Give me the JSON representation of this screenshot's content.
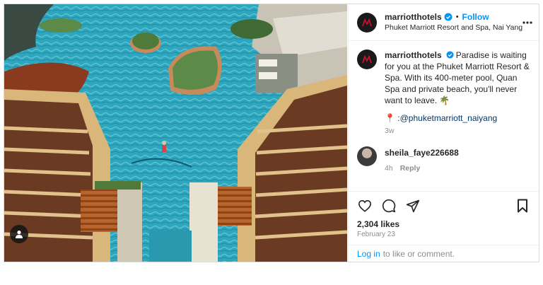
{
  "post": {
    "username": "marriotthotels",
    "follow_label": "Follow",
    "separator": "•",
    "location": "Phuket Marriott Resort and Spa, Nai Yang",
    "caption": "Paradise is waiting for you at the Phuket Marriott Resort & Spa. With its 400-meter pool, Quan Spa and private beach, you'll never want to leave. 🌴",
    "mention_prefix": "📍 : ",
    "mention": "@phuketmarriott_naiyang",
    "caption_age": "3w",
    "likes": "2,304 likes",
    "date": "February 23"
  },
  "reply": {
    "username": "sheila_faye226688",
    "age": "4h",
    "reply_label": "Reply"
  },
  "footer": {
    "login_link": "Log in",
    "login_text": "to like or comment."
  },
  "colors": {
    "accent": "#0095f6",
    "mention": "#00376b",
    "muted": "#8e8e8e"
  },
  "icons": [
    "verified-badge-icon",
    "more-options-icon",
    "heart-icon",
    "comment-icon",
    "share-icon",
    "bookmark-icon",
    "tagged-user-icon"
  ]
}
